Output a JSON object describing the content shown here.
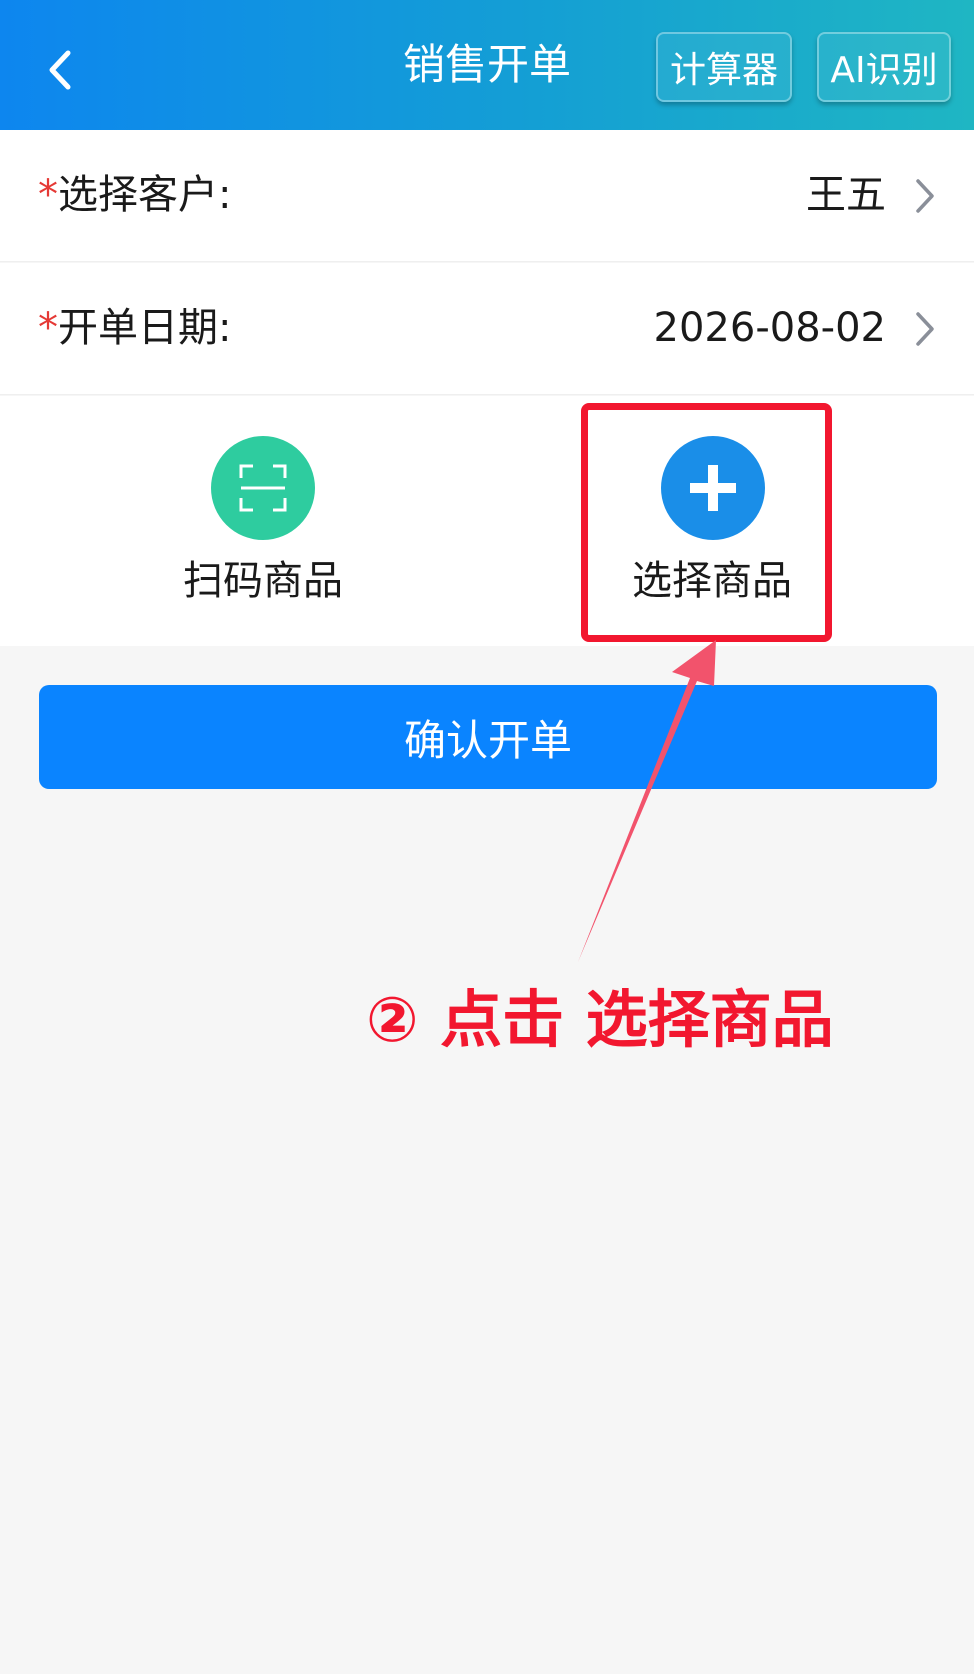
{
  "header": {
    "title": "销售开单",
    "calculator_label": "计算器",
    "ai_label": "AI识别"
  },
  "form": {
    "customer": {
      "required_mark": "*",
      "label": "选择客户:",
      "value": "王五"
    },
    "date": {
      "required_mark": "*",
      "label": "开单日期:",
      "value": "2026-08-02"
    }
  },
  "actions": {
    "scan_label": "扫码商品",
    "select_label": "选择商品"
  },
  "confirm_label": "确认开单",
  "annotation": {
    "text": "② 点击 选择商品",
    "color": "#f2172f"
  },
  "colors": {
    "header_gradient_start": "#0d86ef",
    "header_gradient_end": "#1fb6c3",
    "scan_icon_bg": "#2ecc9f",
    "select_icon_bg": "#1a8ee8",
    "confirm_bg": "#0a84ff",
    "required_star": "#e53935"
  },
  "icons": {
    "back": "chevron-left-icon",
    "scan": "scan-frame-icon",
    "select": "plus-icon",
    "row_arrow": "chevron-right-icon"
  }
}
